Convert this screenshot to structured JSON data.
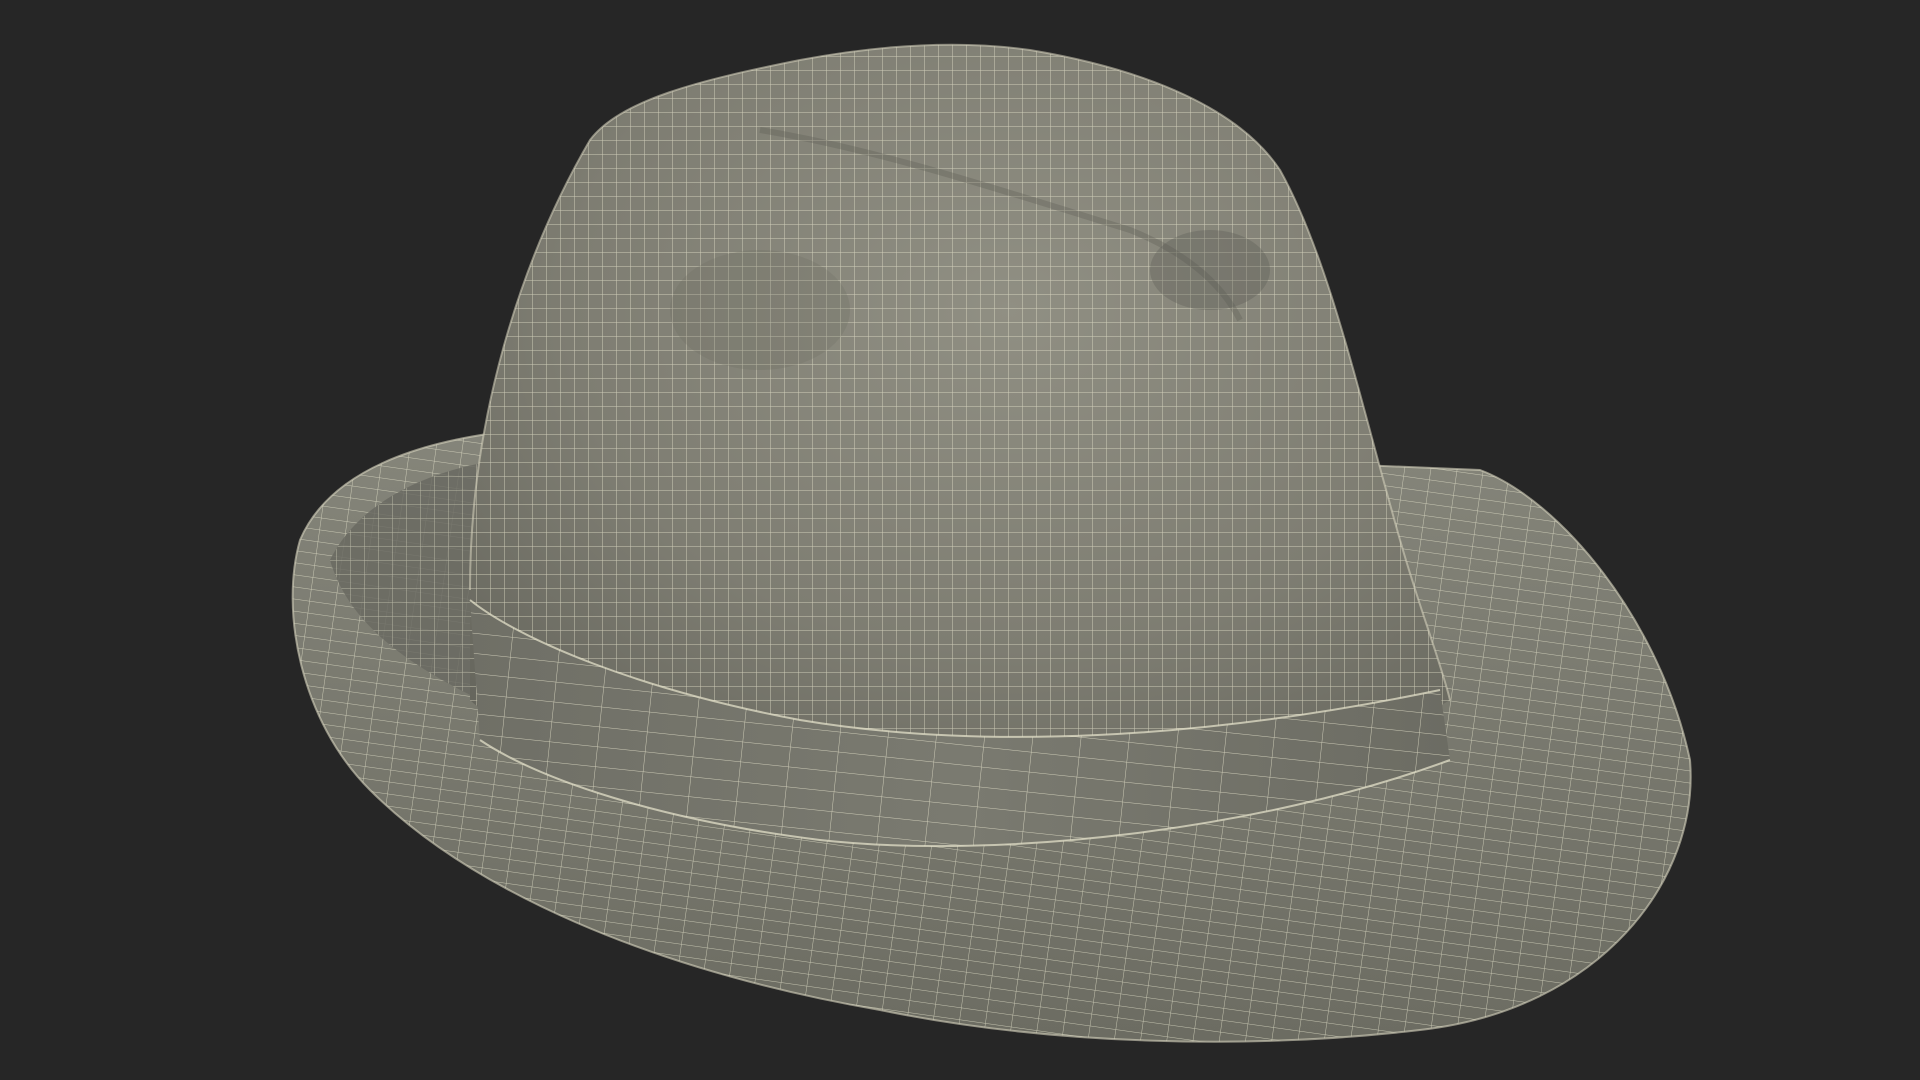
{
  "scene": {
    "subject": "fedora-hat-wireframe",
    "colors": {
      "background": "#262626",
      "surface_light": "#8d8c80",
      "surface_mid": "#76766b",
      "surface_dark": "#4e4e47",
      "band": "#74746a",
      "wire": "#e9e7cf"
    }
  }
}
